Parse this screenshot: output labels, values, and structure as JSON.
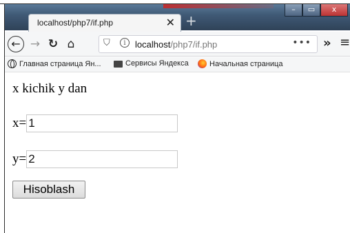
{
  "browser": {
    "tab_title": "localhost/php7/if.php",
    "tab_close": "✕",
    "new_tab": "+",
    "url_host": "localhost",
    "url_path": "/php7/if.php",
    "url_menu": "•••",
    "overflow": "»",
    "menu": "≡",
    "window_buttons": [
      "–",
      "▭",
      "x"
    ]
  },
  "bookmarks": [
    {
      "icon": "globe-icon",
      "label": "Главная страница Ян..."
    },
    {
      "icon": "folder-icon",
      "label": "Сервисы Яндекса"
    },
    {
      "icon": "firefox-icon",
      "label": "Начальная страница"
    }
  ],
  "page": {
    "heading": "x kichik y dan",
    "x_label": "x=",
    "x_value": "1",
    "y_label": "y=",
    "y_value": "2",
    "submit_label": "Hisoblash"
  }
}
